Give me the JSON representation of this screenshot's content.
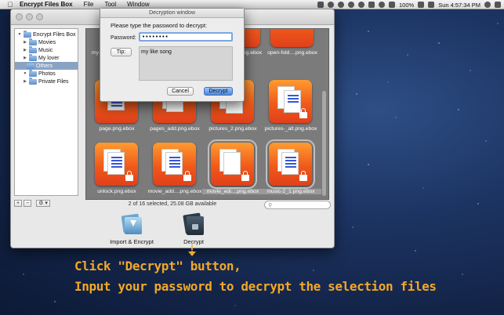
{
  "menubar": {
    "app_name": "Encrypt Files Box",
    "items": [
      "File",
      "Tool",
      "Window"
    ],
    "battery": "100%",
    "clock": "Sun 4:57:34 PM"
  },
  "sidebar": {
    "items": [
      {
        "label": "Encrypt Files Box"
      },
      {
        "label": "Movies"
      },
      {
        "label": "Music"
      },
      {
        "label": "My lover"
      },
      {
        "label": "Others"
      },
      {
        "label": "Photos"
      },
      {
        "label": "Private Files"
      }
    ],
    "add": "+",
    "remove": "−",
    "action": "⚙ ▾"
  },
  "files": [
    {
      "name": "my-"
    },
    {
      "name": "png.ebox"
    },
    {
      "name": "open-fold....png.ebox"
    },
    {
      "name": "page.png.ebox"
    },
    {
      "name": "pages_add.png.ebox"
    },
    {
      "name": "pictures_2.png.ebox"
    },
    {
      "name": "pictures-_alt.png.ebox"
    },
    {
      "name": "unlock.png.ebox"
    },
    {
      "name": "movie_add....png.ebox"
    },
    {
      "name": "movie_edi....png.ebox"
    },
    {
      "name": "music-2_1.png.ebox"
    }
  ],
  "status": "2 of 16 selected, 25.08 GB available",
  "actions": {
    "import": "Import & Encrypt",
    "decrypt": "Decrypt"
  },
  "dialog": {
    "title": "Decryption window",
    "prompt": "Please type the password to decrypt:",
    "password_label": "Password:",
    "password_value": "••••••••",
    "tip_button": "Tip:",
    "tip_text": "my like song",
    "cancel": "Cancel",
    "decrypt": "Decrypt"
  },
  "annotation": {
    "line1": "Click \"Decrypt\" button,",
    "line2": "Input your password to decrypt the selection files"
  },
  "colors": {
    "accent": "#f3a826",
    "tile": "#f05a1a",
    "selection": "#8aa3c4"
  }
}
